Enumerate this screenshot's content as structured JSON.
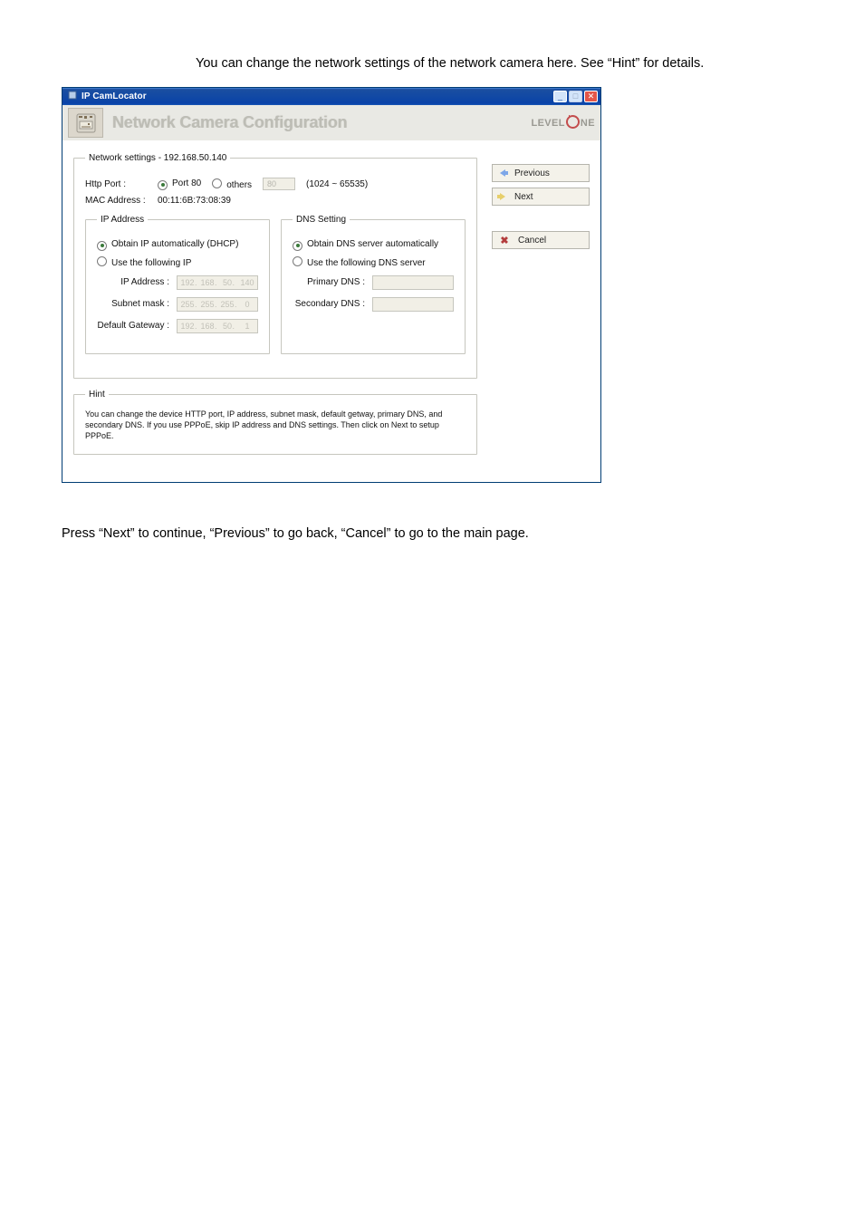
{
  "intro": "You can change the network settings of the network camera here. See “Hint” for details.",
  "window": {
    "title": "IP CamLocator",
    "banner_title": "Network Camera Configuration",
    "brand": "LEVEL NE"
  },
  "sidebar": {
    "previous": "Previous",
    "next": "Next",
    "cancel": "Cancel"
  },
  "ns": {
    "legend": "Network settings - 192.168.50.140",
    "http_port_label": "Http Port :",
    "port80": "Port 80",
    "others_label": "others",
    "others_value": "80",
    "range": "(1024 ~ 65535)",
    "mac_label": "MAC Address :",
    "mac_value": "00:11:6B:73:08:39"
  },
  "ip": {
    "legend": "IP Address",
    "auto": "Obtain IP automatically (DHCP)",
    "manual": "Use the following IP",
    "addr_label": "IP Address :",
    "addr": [
      "192",
      "168",
      "50",
      "140"
    ],
    "mask_label": "Subnet mask :",
    "mask": [
      "255",
      "255",
      "255",
      "0"
    ],
    "gw_label": "Default Gateway :",
    "gw": [
      "192",
      "168",
      "50",
      "1"
    ]
  },
  "dns": {
    "legend": "DNS Setting",
    "auto": "Obtain DNS server automatically",
    "manual": "Use the following DNS server",
    "pri_label": "Primary DNS :",
    "sec_label": "Secondary DNS :"
  },
  "hint": {
    "legend": "Hint",
    "text": "You can change the device HTTP port, IP address, subnet mask, default getway, primary DNS, and secondary DNS. If you use PPPoE, skip IP address and DNS settings. Then click on Next to setup PPPoE."
  },
  "outro": "Press “Next” to continue, “Previous” to go back, “Cancel” to go to the main page."
}
